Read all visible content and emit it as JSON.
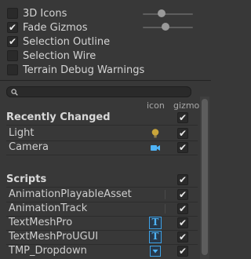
{
  "options": [
    {
      "label": "3D Icons",
      "checked": false,
      "slider": 0.35
    },
    {
      "label": "Fade Gizmos",
      "checked": true,
      "slider": 0.45
    },
    {
      "label": "Selection Outline",
      "checked": true
    },
    {
      "label": "Selection Wire",
      "checked": false
    },
    {
      "label": "Terrain Debug Warnings",
      "checked": false
    }
  ],
  "search": {
    "placeholder": "",
    "value": ""
  },
  "columns": {
    "icon": "icon",
    "gizmo": "gizmo"
  },
  "sections": [
    {
      "title": "Recently Changed",
      "header_checked": true,
      "items": [
        {
          "name": "Light",
          "icon": "lightbulb-icon",
          "gizmo_checked": true
        },
        {
          "name": "Camera",
          "icon": "camera-icon",
          "gizmo_checked": true
        }
      ]
    },
    {
      "title": "Scripts",
      "header_checked": true,
      "items": [
        {
          "name": "AnimationPlayableAsset",
          "icon": "",
          "gizmo_checked": true
        },
        {
          "name": "AnimationTrack",
          "icon": "",
          "gizmo_checked": true
        },
        {
          "name": "TextMeshPro",
          "icon": "text-mesh-icon",
          "icon_glyph": "T",
          "gizmo_checked": true
        },
        {
          "name": "TextMeshProUGUI",
          "icon": "text-mesh-icon",
          "icon_glyph": "T",
          "gizmo_checked": true
        },
        {
          "name": "TMP_Dropdown",
          "icon": "dropdown-icon",
          "gizmo_checked": true
        }
      ]
    }
  ],
  "colors": {
    "background": "#383838",
    "accent_icon": "#4fb3f6",
    "light_icon": "#c9a53a"
  }
}
